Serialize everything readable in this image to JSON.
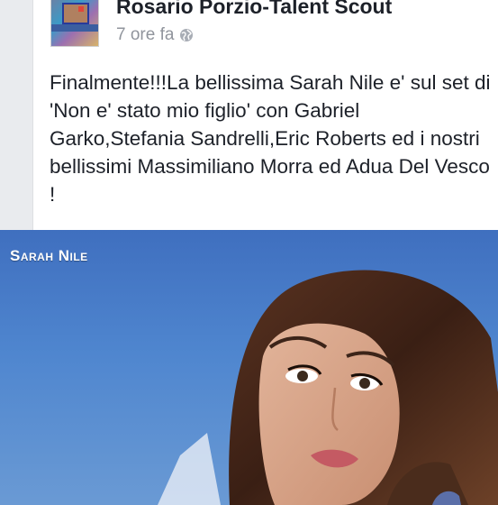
{
  "post": {
    "author": "Rosario Porzio-Talent Scout",
    "timestamp": "7 ore fa",
    "privacy_icon": "globe-icon",
    "text": "Finalmente!!!La bellissima Sarah Nile e' sul set di 'Non e' stato mio figlio' con Gabriel Garko,Stefania Sandrelli,Eric Roberts ed i nostri bellissimi Massimiliano Morra ed Adua Del Vesco !"
  },
  "photo": {
    "caption": "Sarah Nile"
  },
  "colors": {
    "background": "#e9ebee",
    "card": "#ffffff",
    "text": "#1d2129",
    "meta": "#90949c",
    "photo_blue": "#4f86cf"
  }
}
